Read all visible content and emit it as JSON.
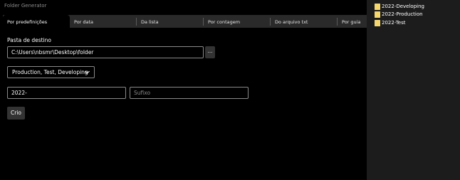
{
  "window": {
    "title": "Folder Generator"
  },
  "tabs": [
    {
      "label": "Por predefinições",
      "active": true
    },
    {
      "label": "Por data"
    },
    {
      "label": "Da lista"
    },
    {
      "label": "Por contagem"
    },
    {
      "label": "Do arquivo txt"
    },
    {
      "label": "Por guia"
    }
  ],
  "form": {
    "destination_label": "Pasta de destino",
    "destination_value": "C:\\Users\\nbsmr\\Desktop\\folder",
    "browse_label": "...",
    "preset_selected": "Production, Test, Developing",
    "prefix_value": "2022-",
    "suffix_placeholder": "Sufixo",
    "create_label": "Crio"
  },
  "folder_list": {
    "items": [
      "2022-Developing",
      "2022-Production",
      "2022-Test"
    ],
    "folder_icon": "folder-icon"
  },
  "colors": {
    "background": "#000000",
    "tab_strip": "#2a2a2a",
    "side_panel": "#1c1c1c",
    "folder_icon": "#f5d76e",
    "border": "#8a8a8a",
    "button": "#333333"
  }
}
